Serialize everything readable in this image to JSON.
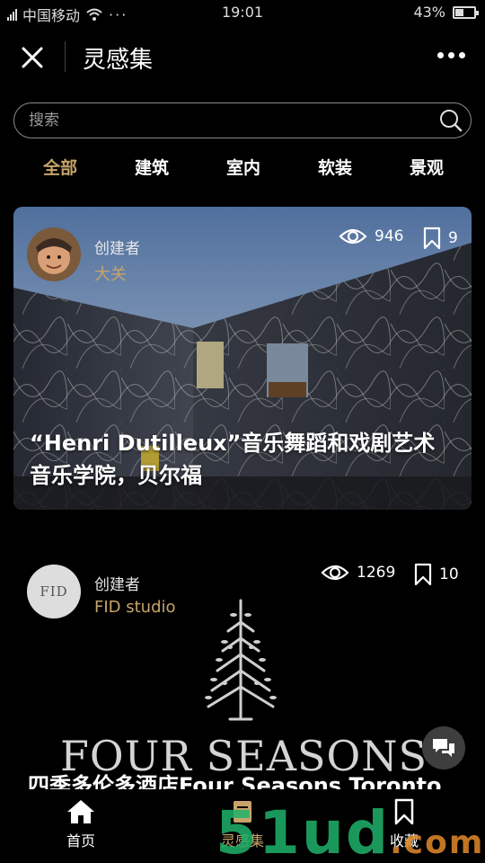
{
  "status_bar": {
    "carrier": "中国移动",
    "time": "19:01",
    "battery": "43%",
    "battery_level": 0.43
  },
  "nav": {
    "title": "灵感集"
  },
  "search": {
    "placeholder": "搜索"
  },
  "categories": [
    {
      "label": "全部",
      "active": true
    },
    {
      "label": "建筑",
      "active": false
    },
    {
      "label": "室内",
      "active": false
    },
    {
      "label": "软装",
      "active": false
    },
    {
      "label": "景观",
      "active": false
    }
  ],
  "cards": [
    {
      "creator_role": "创建者",
      "creator_name": "大关",
      "views": "946",
      "bookmarks": "9",
      "title_line1": "“Henri Dutilleux”音乐舞蹈和戏剧艺术",
      "title_line2": "音乐学院，贝尔福"
    },
    {
      "creator_role": "创建者",
      "creator_name": "FID studio",
      "avatar_text": "FID",
      "views": "1269",
      "bookmarks": "10",
      "logo_text": "FOUR SEASONS",
      "title": "四季多伦多酒店Four Seasons Toronto"
    }
  ],
  "tabbar": [
    {
      "label": "首页",
      "icon": "home-icon"
    },
    {
      "label": "灵感集",
      "icon": "inspiration-icon"
    },
    {
      "label": "收藏",
      "icon": "bookmark-icon"
    }
  ],
  "watermark": {
    "main": "51ud",
    "suffix": ".com"
  },
  "colors": {
    "accent": "#c8a46a",
    "background": "#000000",
    "green": "#1fb36b"
  }
}
